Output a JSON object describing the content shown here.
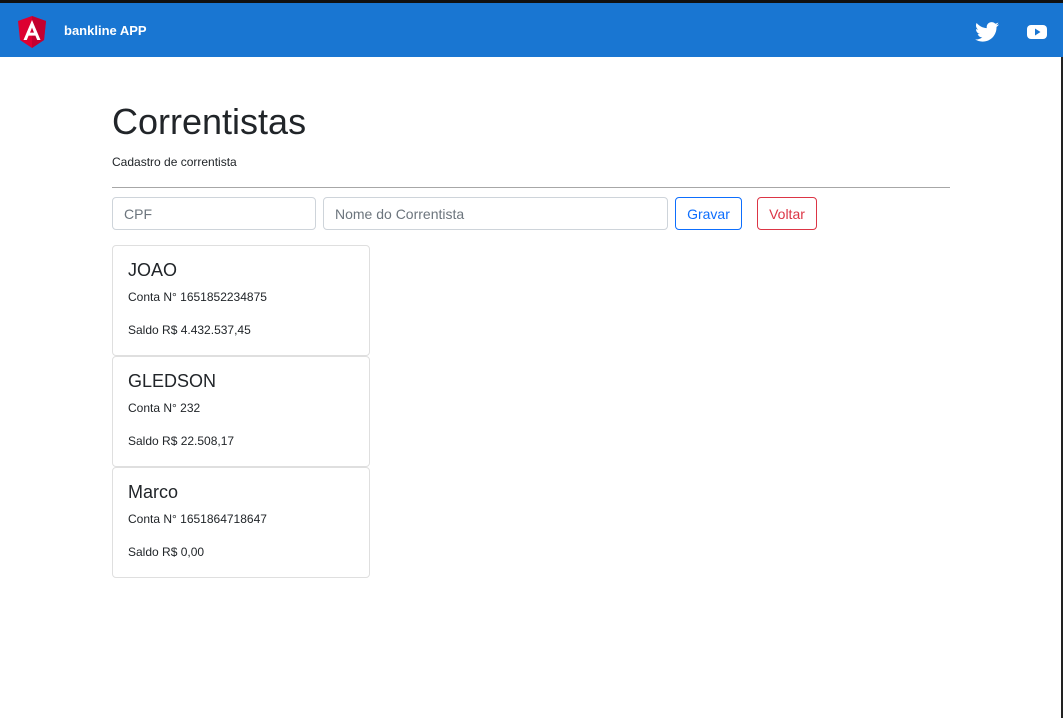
{
  "header": {
    "app_title": "bankline APP",
    "icons": [
      "angular-logo-icon",
      "twitter-icon",
      "youtube-icon"
    ]
  },
  "page": {
    "title": "Correntistas",
    "subtitle": "Cadastro de correntista"
  },
  "form": {
    "cpf_placeholder": "CPF",
    "nome_placeholder": "Nome do Correntista",
    "save_label": "Gravar",
    "back_label": "Voltar"
  },
  "accounts": [
    {
      "name": "JOAO",
      "conta": "Conta N° 1651852234875",
      "saldo": "Saldo R$ 4.432.537,45"
    },
    {
      "name": "GLEDSON",
      "conta": "Conta N° 232",
      "saldo": "Saldo R$ 22.508,17"
    },
    {
      "name": "Marco",
      "conta": "Conta N° 1651864718647",
      "saldo": "Saldo R$ 0,00"
    }
  ],
  "colors": {
    "header_bg": "#1976d2",
    "primary": "#0d6efd",
    "danger": "#dc3545",
    "angular_red": "#dd0031"
  }
}
